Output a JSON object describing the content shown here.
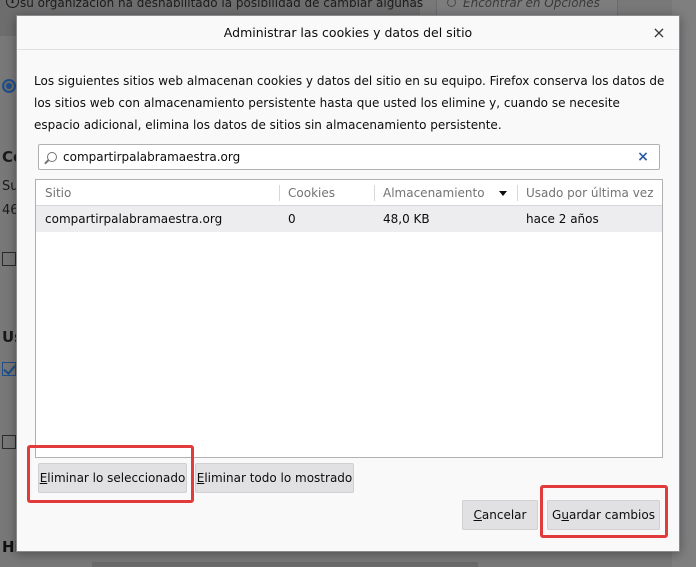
{
  "background": {
    "banner_text": "su organización ha deshabilitado la posibilidad de cambiar algunas",
    "search_placeholder": "Encontrar en Opciones",
    "fragments": [
      "Co",
      "Su",
      "46",
      "Us",
      "Historial"
    ]
  },
  "dialog": {
    "title": "Administrar las cookies y datos del sitio",
    "close_label": "×",
    "description": "Los siguientes sitios web almacenan cookies y datos del sitio en su equipo. Firefox conserva los datos de los sitios web con almacenamiento persistente hasta que usted los elimine y, cuando se necesite espacio adicional, elimina los datos de sitios sin almacenamiento persistente.",
    "filter": {
      "value": "compartirpalabramaestra.org",
      "clear_label": "×"
    },
    "table": {
      "columns": [
        "Sitio",
        "Cookies",
        "Almacenamiento",
        "Usado por última vez"
      ],
      "rows": [
        [
          "compartirpalabramaestra.org",
          "0",
          "48,0 KB",
          "hace 2 años"
        ]
      ]
    },
    "buttons": {
      "remove_selected": {
        "accesskey": "E",
        "rest": "liminar lo seleccionado"
      },
      "remove_all_shown": {
        "accesskey": "E",
        "rest": "liminar todo lo mostrado"
      },
      "cancel": {
        "accesskey": "C",
        "rest": "ancelar"
      },
      "save": {
        "prefix": "G",
        "accesskey": "u",
        "rest": "ardar cambios"
      }
    }
  },
  "colors": {
    "highlight": "#e23b3b",
    "selected_row": "#ededf0",
    "clear_icon": "#2b5aa8"
  }
}
